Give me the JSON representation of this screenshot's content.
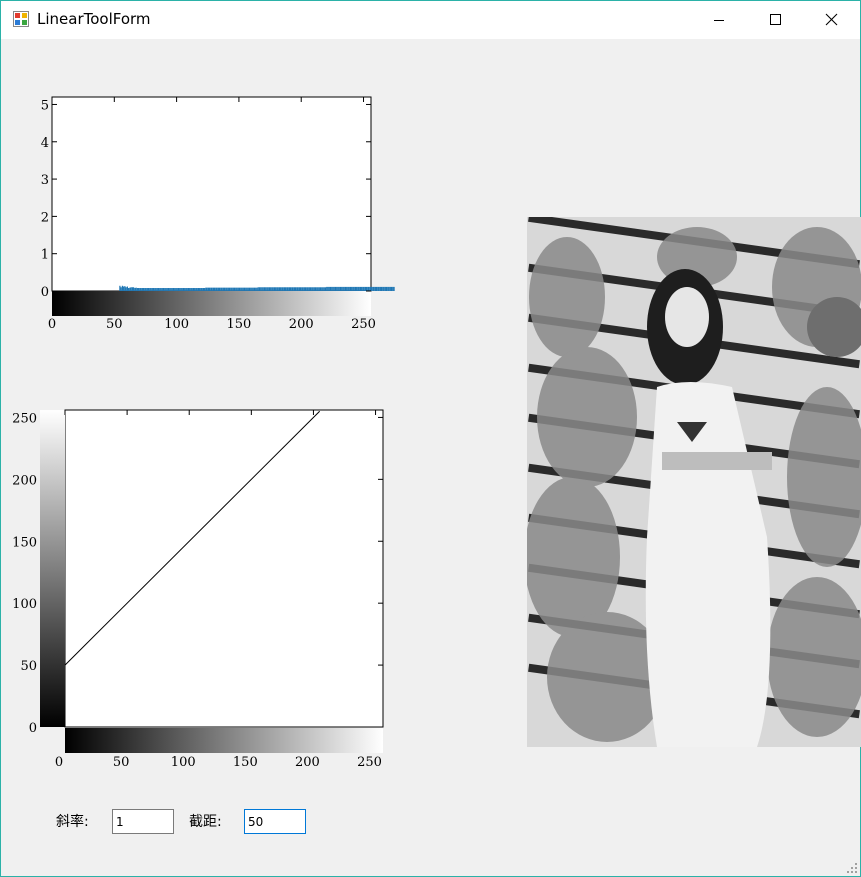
{
  "window": {
    "title": "LinearToolForm"
  },
  "histogram": {
    "y_ticks": [
      "0",
      "1",
      "2",
      "3",
      "4",
      "5"
    ],
    "x_ticks": [
      "0",
      "50",
      "100",
      "150",
      "200",
      "250"
    ],
    "bar_color": "#1f77b4"
  },
  "transform": {
    "y_ticks": [
      "0",
      "50",
      "100",
      "150",
      "200",
      "250"
    ],
    "x_ticks": [
      "0",
      "50",
      "100",
      "150",
      "200",
      "250"
    ]
  },
  "chart_data": [
    {
      "type": "bar",
      "x_range": [
        0,
        256
      ],
      "ylim": [
        0,
        5.2
      ],
      "values": [
        0,
        0,
        0,
        0,
        0,
        0,
        0,
        0,
        0,
        0,
        0,
        0,
        0,
        0,
        0,
        0,
        0,
        0,
        0,
        0,
        0,
        0,
        0,
        0,
        0,
        0,
        0,
        0,
        0,
        0,
        0,
        0,
        0,
        0,
        0,
        0,
        0,
        0,
        0,
        0,
        0,
        0,
        0,
        0,
        0,
        0,
        0,
        0,
        0,
        0,
        0,
        0,
        0,
        0,
        0.14,
        0.1,
        0.14,
        0.12,
        0.13,
        0.1,
        0.12,
        0.08,
        0.09,
        0.1,
        0.1,
        0.1,
        0.08,
        0.09,
        0.08,
        0.08,
        0.08,
        0.08,
        0.08,
        0.08,
        0.08,
        0.08,
        0.08,
        0.08,
        0.08,
        0.08,
        0.08,
        0.08,
        0.08,
        0.08,
        0.08,
        0.08,
        0.08,
        0.08,
        0.08,
        0.08,
        0.08,
        0.08,
        0.08,
        0.08,
        0.08,
        0.08,
        0.08,
        0.08,
        0.08,
        0.08,
        0.08,
        0.08,
        0.08,
        0.08,
        0.08,
        0.08,
        0.08,
        0.08,
        0.08,
        0.08,
        0.08,
        0.08,
        0.08,
        0.08,
        0.08,
        0.08,
        0.08,
        0.08,
        0.08,
        0.08,
        0.08,
        0.08,
        0.08,
        0.09,
        0.09,
        0.09,
        0.09,
        0.09,
        0.09,
        0.09,
        0.09,
        0.09,
        0.09,
        0.09,
        0.09,
        0.09,
        0.09,
        0.09,
        0.09,
        0.09,
        0.09,
        0.09,
        0.09,
        0.09,
        0.09,
        0.09,
        0.09,
        0.09,
        0.09,
        0.09,
        0.09,
        0.09,
        0.09,
        0.09,
        0.09,
        0.09,
        0.09,
        0.09,
        0.09,
        0.09,
        0.09,
        0.09,
        0.09,
        0.09,
        0.09,
        0.1,
        0.1,
        0.1,
        0.1,
        0.1,
        0.1,
        0.1,
        0.1,
        0.1,
        0.1,
        0.1,
        0.1,
        0.1,
        0.1,
        0.1,
        0.1,
        0.1,
        0.1,
        0.1,
        0.1,
        0.1,
        0.1,
        0.1,
        0.1,
        0.1,
        0.1,
        0.1,
        0.1,
        0.1,
        0.1,
        0.1,
        0.1,
        0.1,
        0.1,
        0.1,
        0.1,
        0.1,
        0.1,
        0.1,
        0.1,
        0.1,
        0.1,
        0.1,
        0.1,
        0.1,
        0.1,
        0.1,
        0.1,
        0.1,
        0.1,
        0.1,
        0.1,
        0.1,
        0.1,
        0.1,
        0.11,
        0.11,
        0.11,
        0.11,
        0.11,
        0.11,
        0.11,
        0.11,
        0.11,
        0.11,
        0.11,
        0.11,
        0.11,
        0.11,
        0.11,
        0.11,
        0.11,
        0.11,
        0.11,
        0.11,
        0.11,
        0.11,
        0.11,
        0.11,
        0.11,
        0.11,
        0.11,
        0.11,
        0.11,
        0.11,
        0.11,
        0.11,
        0.11,
        0.11,
        0.11,
        0.11,
        0.11,
        0.11,
        0.11,
        0.11,
        0.11,
        0.11,
        0.11,
        0.11,
        0.11,
        0.11,
        0.11,
        0.11,
        0.11,
        0.11,
        0.11,
        0.11,
        0.11,
        0.11,
        0.11
      ]
    },
    {
      "type": "line",
      "xlim": [
        0,
        256
      ],
      "ylim": [
        0,
        256
      ],
      "x": [
        0,
        205
      ],
      "y": [
        50,
        255
      ]
    }
  ],
  "controls": {
    "slope_label": "斜率:",
    "slope_value": "1",
    "intercept_label": "截距:",
    "intercept_value": "50"
  },
  "image": {
    "description_icon": "grayscale-photo"
  }
}
